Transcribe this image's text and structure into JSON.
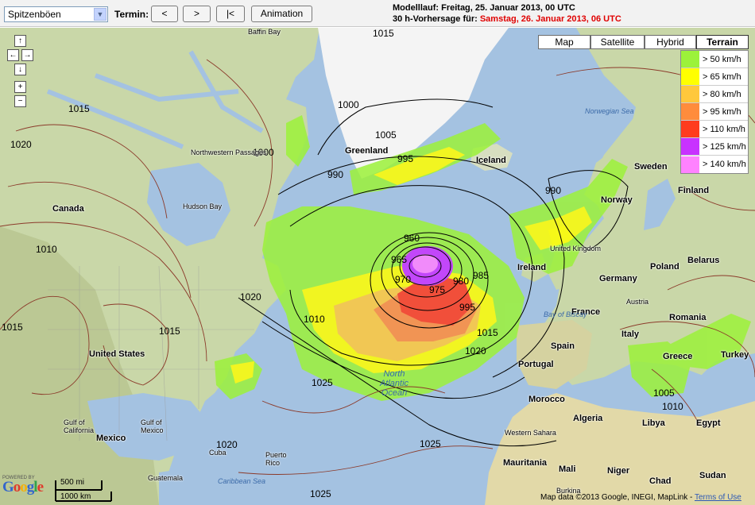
{
  "toolbar": {
    "parameter": "Spitzenböen",
    "termin_label": "Termin:",
    "prev_label": "<",
    "next_label": ">",
    "first_label": "|<",
    "animation_label": "Animation",
    "run_line": "Modelllauf: Freitag, 25. Januar 2013, 00 UTC",
    "forecast_prefix": "30 h-Vorhersage für:",
    "forecast_date": "Samstag, 26. Januar 2013, 06 UTC"
  },
  "map_types": [
    {
      "label": "Map",
      "active": false
    },
    {
      "label": "Satellite",
      "active": false
    },
    {
      "label": "Hybrid",
      "active": false
    },
    {
      "label": "Terrain",
      "active": true
    }
  ],
  "legend": [
    {
      "label": "> 50 km/h",
      "color": "#9cf23a"
    },
    {
      "label": "> 65 km/h",
      "color": "#ffff00"
    },
    {
      "label": "> 80 km/h",
      "color": "#ffc83c"
    },
    {
      "label": "> 95 km/h",
      "color": "#ff8c3c"
    },
    {
      "label": "> 110 km/h",
      "color": "#ff3c1e"
    },
    {
      "label": "> 125 km/h",
      "color": "#c832ff"
    },
    {
      "label": "> 140 km/h",
      "color": "#ff82ff"
    }
  ],
  "nav": {
    "up": "↑",
    "left": "←",
    "right": "→",
    "down": "↓",
    "zoom_in": "+",
    "zoom_out": "−"
  },
  "places": {
    "baffin_bay": "Baffin Bay",
    "greenland": "Greenland",
    "iceland": "Iceland",
    "norwegian_sea": "Norwegian Sea",
    "sweden": "Sweden",
    "finland": "Finland",
    "norway": "Norway",
    "canada": "Canada",
    "hudson_bay": "Hudson Bay",
    "northwest_passages": "Northwestern Passages",
    "united_kingdom": "United Kingdom",
    "ireland": "Ireland",
    "germany": "Germany",
    "belarus": "Belarus",
    "poland": "Poland",
    "france": "France",
    "austria": "Austria",
    "romania": "Romania",
    "italy": "Italy",
    "spain": "Spain",
    "portugal": "Portugal",
    "greece": "Greece",
    "turkey": "Turkey",
    "bay_of_biscay": "Bay of Biscay",
    "morocco": "Morocco",
    "algeria": "Algeria",
    "libya": "Libya",
    "egypt": "Egypt",
    "western_sahara": "Western Sahara",
    "mauritania": "Mauritania",
    "mali": "Mali",
    "niger": "Niger",
    "chad": "Chad",
    "sudan": "Sudan",
    "burkina": "Burkina",
    "north_atlantic": "North Atlantic Ocean",
    "united_states": "United States",
    "mexico": "Mexico",
    "gulf_of_california": "Gulf of California",
    "gulf_of_mexico": "Gulf of Mexico",
    "cuba": "Cuba",
    "puerto_rico": "Puerto Rico",
    "guatemala": "Guatemala",
    "caribbean_sea": "Caribbean Sea"
  },
  "isobars": [
    "1015",
    "1000",
    "1015",
    "1020",
    "1005",
    "995",
    "990",
    "1000",
    "990",
    "1010",
    "965",
    "960",
    "970",
    "975",
    "980",
    "985",
    "995",
    "1010",
    "1015",
    "1020",
    "1020",
    "1025",
    "1025",
    "1020",
    "1005",
    "1010",
    "1015",
    "1025",
    "1015"
  ],
  "google": {
    "powered_by": "POWERED BY",
    "logo": "Google"
  },
  "scale": {
    "miles": "500 mi",
    "km": "1000 km"
  },
  "attribution": {
    "text": "Map data ©2013 Google, INEGI, MapLink -",
    "terms": "Terms of Use"
  }
}
